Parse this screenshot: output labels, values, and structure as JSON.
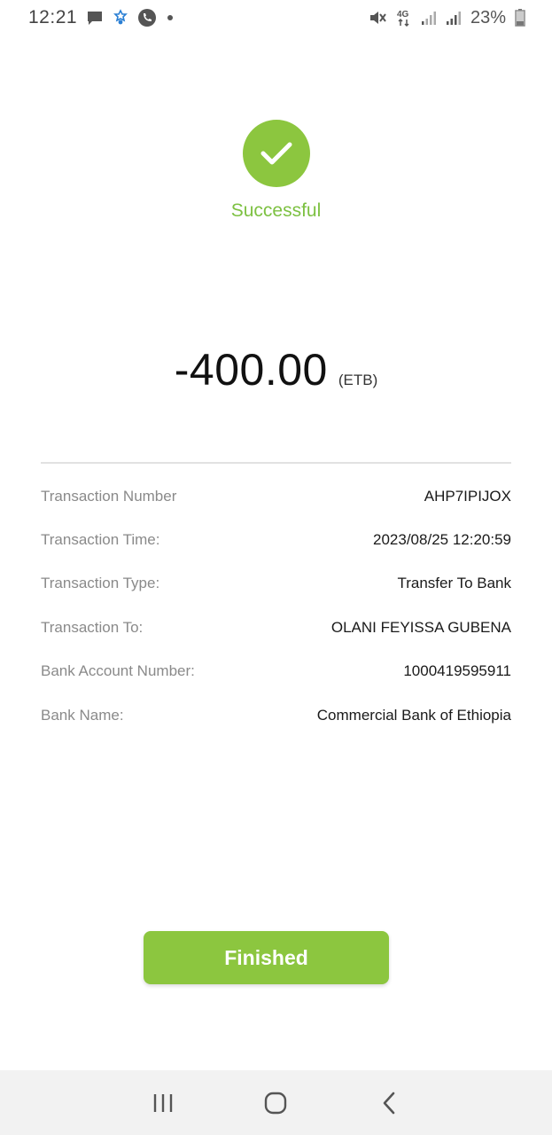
{
  "status_bar": {
    "time": "12:21",
    "battery": "23%",
    "network": "4G",
    "icons": [
      "message-icon",
      "app-notification-icon",
      "whatsapp-icon",
      "dot-icon",
      "mute-icon",
      "network-4g-icon",
      "signal-icon",
      "signal-icon",
      "battery-icon"
    ]
  },
  "result": {
    "status": "Successful",
    "icon": "check-icon",
    "accent_color": "#8cc63f"
  },
  "amount": {
    "value": "-400.00",
    "currency": "(ETB)"
  },
  "details": [
    {
      "label": "Transaction Number",
      "value": "AHP7IPIJOX"
    },
    {
      "label": "Transaction Time:",
      "value": "2023/08/25 12:20:59"
    },
    {
      "label": "Transaction Type:",
      "value": "Transfer To Bank"
    },
    {
      "label": "Transaction To:",
      "value": "OLANI FEYISSA GUBENA"
    },
    {
      "label": "Bank Account Number:",
      "value": "1000419595911"
    },
    {
      "label": "Bank Name:",
      "value": "Commercial Bank of Ethiopia"
    }
  ],
  "actions": {
    "finish_label": "Finished"
  },
  "nav_bar": {
    "icons": [
      "recent-apps-icon",
      "home-icon",
      "back-icon"
    ]
  }
}
